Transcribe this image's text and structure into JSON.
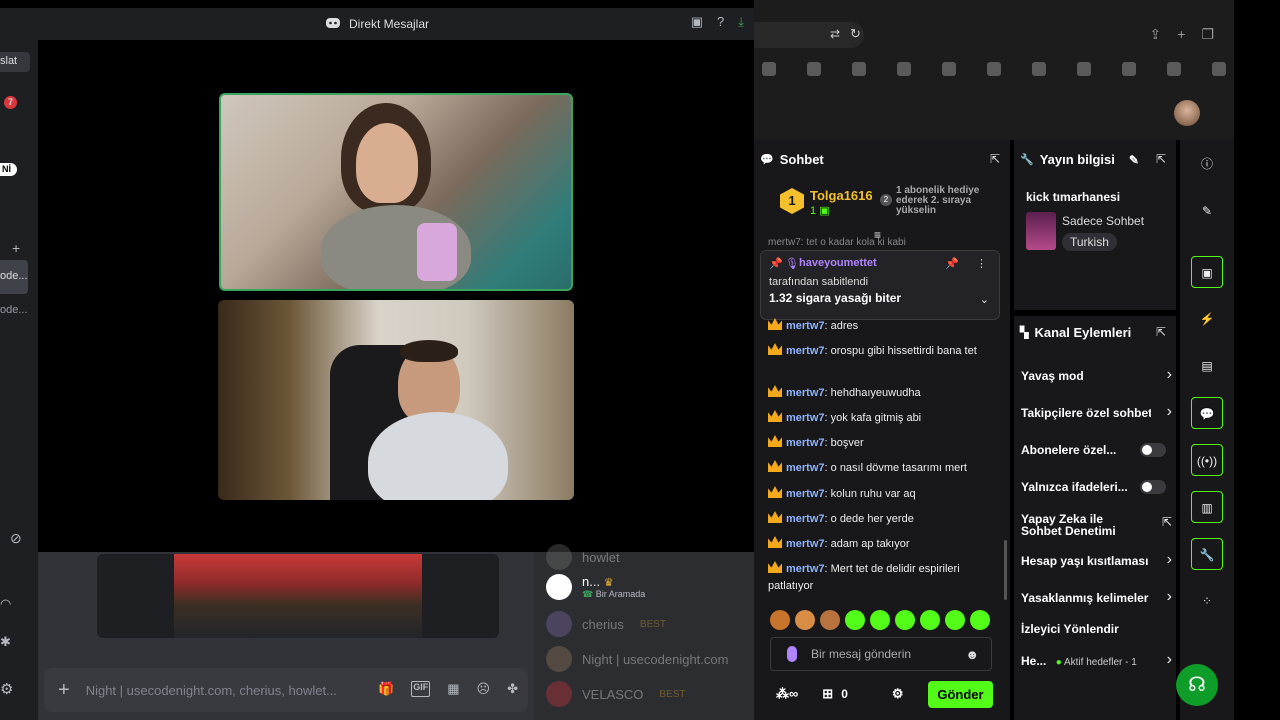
{
  "discord": {
    "title": "Direkt Mesajlar",
    "sidebar": {
      "label_top": "slat",
      "badge_count": "7",
      "badge_new": "Nİ",
      "item1": "ode...",
      "item2": "ode..."
    },
    "input_placeholder": "Night | usecodenight.com, cherius, howlet...",
    "members": [
      {
        "name": "howlet",
        "status": ""
      },
      {
        "name": "n...",
        "status": "Bir Aramada"
      },
      {
        "name": "cherius",
        "status": "",
        "badge": "BEST"
      },
      {
        "name": "Night | usecodenight.com",
        "status": ""
      },
      {
        "name": "VELASCO",
        "status": "",
        "badge": "BEST"
      }
    ]
  },
  "chat": {
    "title": "Sohbet",
    "top_gifter": {
      "rank": "1",
      "name": "Tolga1616",
      "count": "1",
      "rank2": "2",
      "note": "1 abonelik hediye ederek 2. sıraya yükselin"
    },
    "pinned": {
      "user": "haveyoumettet",
      "sub": "tarafından sabitlendi",
      "message": "1.32 sigara yasağı biter"
    },
    "partial_top": "mertw7: tet o kadar kola ki kabi",
    "messages": [
      {
        "user": "mertw7",
        "text": ": adres"
      },
      {
        "user": "mertw7",
        "text": ": orospu gibi hissettirdi bana tet"
      },
      {
        "user": "mertw7",
        "text": ": hehdhaıyeuwudha"
      },
      {
        "user": "mertw7",
        "text": ": yok kafa gitmiş abi"
      },
      {
        "user": "mertw7",
        "text": ": boşver"
      },
      {
        "user": "mertw7",
        "text": ": o nasıl dövme tasarımı mert"
      },
      {
        "user": "mertw7",
        "text": ": kolun ruhu var aq"
      },
      {
        "user": "mertw7",
        "text": ": o dede her yerde"
      },
      {
        "user": "mertw7",
        "text": ": adam ap takıyor"
      },
      {
        "user": "mertw7",
        "text": ": Mert tet de delidir espirileri patlatıyor"
      }
    ],
    "input_placeholder": "Bir mesaj gönderin",
    "points": "0",
    "send_label": "Gönder"
  },
  "stream_info": {
    "title": "Yayın bilgisi",
    "stream_title": "kick tımarhanesi",
    "category": "Sadece Sohbet",
    "language": "Turkish"
  },
  "channel_actions": {
    "title": "Kanal Eylemleri",
    "items": [
      {
        "label": "Yavaş mod",
        "kind": "chevron"
      },
      {
        "label": "Takipçilere özel sohbet",
        "kind": "chevron"
      },
      {
        "label": "Abonelere özel...",
        "kind": "toggle"
      },
      {
        "label": "Yalnızca ifadeleri...",
        "kind": "toggle"
      },
      {
        "label": "Yapay Zeka ile Sohbet Denetimi",
        "kind": "external"
      },
      {
        "label": "Hesap yaşı kısıtlaması",
        "kind": "chevron"
      },
      {
        "label": "Yasaklanmış kelimeler",
        "kind": "chevron"
      },
      {
        "label": "İzleyici Yönlendir",
        "kind": "none"
      },
      {
        "label": "He...",
        "sub": "Aktif hedefler - 1",
        "kind": "chevron"
      }
    ]
  },
  "colors": {
    "kick_green": "#53fc18",
    "discord_green": "#3ba55d",
    "sub_gold": "#f4a81c"
  }
}
